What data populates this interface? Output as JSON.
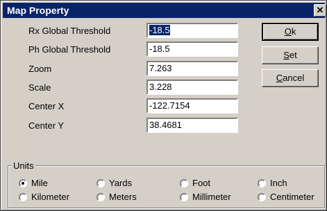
{
  "window": {
    "title": "Map Property",
    "close_glyph": "✕"
  },
  "fields": [
    {
      "label": "Rx Global Threshold",
      "value": "-18.5",
      "selected": true
    },
    {
      "label": "Ph Global Threshold",
      "value": "-18.5"
    },
    {
      "label": "Zoom",
      "value": "7.263"
    },
    {
      "label": "Scale",
      "value": "3.228"
    },
    {
      "label": "Center X",
      "value": "-122.7154"
    },
    {
      "label": "Center Y",
      "value": "38.4681"
    }
  ],
  "buttons": {
    "ok": {
      "mnemonic": "O",
      "rest": "k"
    },
    "set": {
      "mnemonic": "S",
      "rest": "et"
    },
    "cancel": {
      "mnemonic": "C",
      "rest": "ancel"
    }
  },
  "units": {
    "title": "Units",
    "options": [
      {
        "label": "Mile",
        "checked": true
      },
      {
        "label": "Yards"
      },
      {
        "label": "Foot"
      },
      {
        "label": "Inch"
      },
      {
        "label": "Kilometer"
      },
      {
        "label": "Meters"
      },
      {
        "label": "Millimeter"
      },
      {
        "label": "Centimeter"
      }
    ]
  }
}
